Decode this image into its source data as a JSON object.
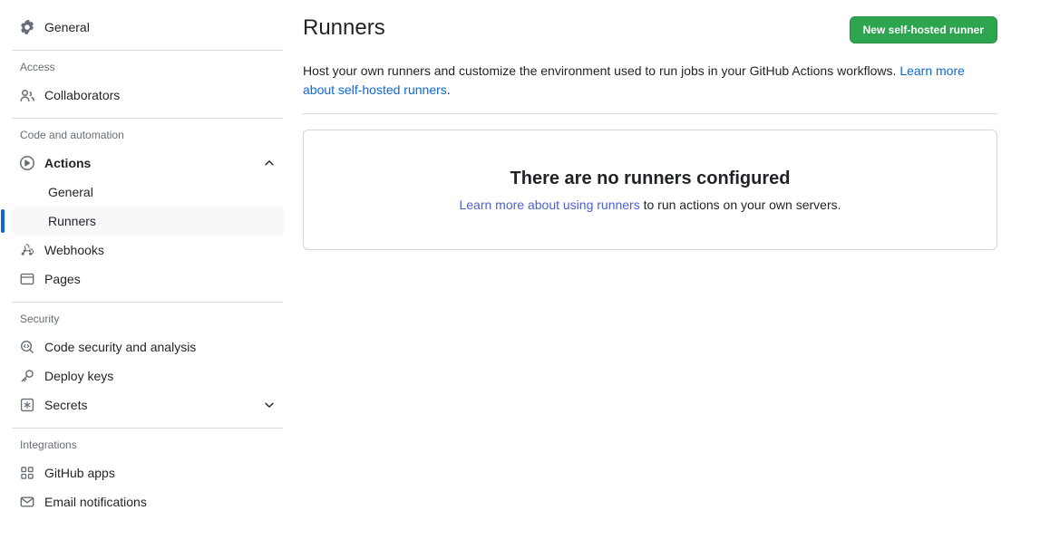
{
  "sidebar": {
    "top_items": [
      {
        "label": "General",
        "icon": "gear-icon",
        "name": "sidebar-item-general"
      }
    ],
    "sections": [
      {
        "heading": "Access",
        "items": [
          {
            "label": "Collaborators",
            "icon": "people-icon",
            "name": "sidebar-item-collaborators"
          }
        ]
      },
      {
        "heading": "Code and automation",
        "items": [
          {
            "label": "Actions",
            "icon": "play-circle-icon",
            "name": "sidebar-item-actions",
            "expanded": true,
            "chevron": "chevron-up-icon"
          },
          {
            "label": "Webhooks",
            "icon": "webhook-icon",
            "name": "sidebar-item-webhooks"
          },
          {
            "label": "Pages",
            "icon": "browser-icon",
            "name": "sidebar-item-pages"
          }
        ],
        "sub_items": [
          {
            "label": "General",
            "name": "sidebar-subitem-general",
            "selected": false
          },
          {
            "label": "Runners",
            "name": "sidebar-subitem-runners",
            "selected": true
          }
        ]
      },
      {
        "heading": "Security",
        "items": [
          {
            "label": "Code security and analysis",
            "icon": "code-scan-icon",
            "name": "sidebar-item-code-security"
          },
          {
            "label": "Deploy keys",
            "icon": "key-icon",
            "name": "sidebar-item-deploy-keys"
          },
          {
            "label": "Secrets",
            "icon": "asterisk-box-icon",
            "name": "sidebar-item-secrets",
            "chevron": "chevron-down-icon"
          }
        ]
      },
      {
        "heading": "Integrations",
        "items": [
          {
            "label": "GitHub apps",
            "icon": "apps-grid-icon",
            "name": "sidebar-item-github-apps"
          },
          {
            "label": "Email notifications",
            "icon": "mail-icon",
            "name": "sidebar-item-email-notifications"
          }
        ]
      }
    ]
  },
  "main": {
    "title": "Runners",
    "new_runner_button": "New self-hosted runner",
    "description": {
      "text_before": "Host your own runners and customize the environment used to run jobs in your GitHub Actions workflows. ",
      "link_text": "Learn more about self-hosted runners",
      "text_after": "."
    },
    "empty_state": {
      "title": "There are no runners configured",
      "link_text": "Learn more about using runners",
      "sub_after": " to run actions on your own servers."
    }
  },
  "colors": {
    "accent_green": "#2da44e",
    "link_blue": "#0969da",
    "link_visited": "#4b61d1",
    "selected_bar": "#0969da",
    "selected_bg": "#f6f8fa",
    "border": "#d0d7de"
  }
}
